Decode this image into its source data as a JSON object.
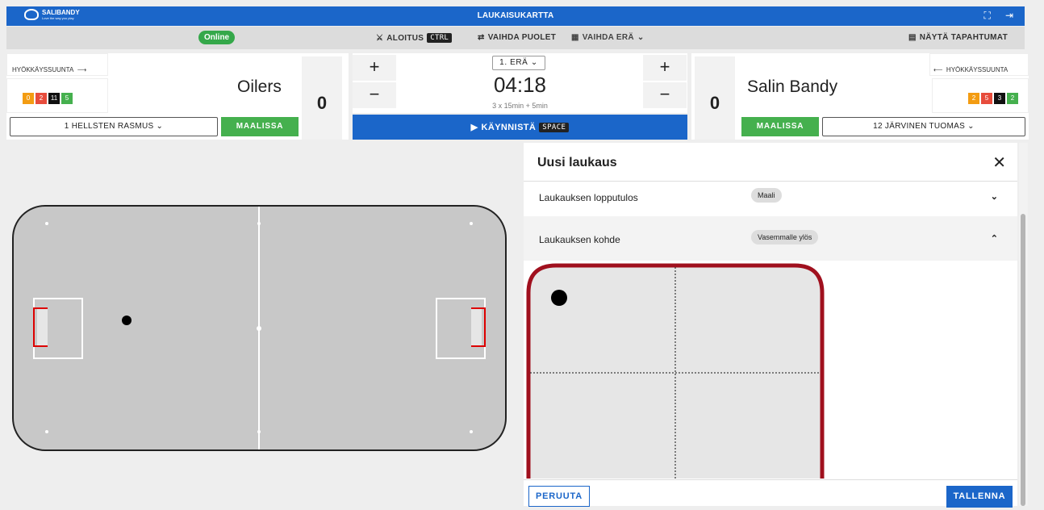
{
  "topbar": {
    "logo_text": "SALIBANDY",
    "logo_tagline": "Love the way you play",
    "title": "LAUKAISUKARTTA",
    "fullscreen_icon": "fullscreen-icon",
    "logout_icon": "logout-icon"
  },
  "toolbar": {
    "status": "Online",
    "faceoff_label": "ALOITUS",
    "faceoff_key": "CTRL",
    "switch_sides_label": "VAIHDA PUOLET",
    "switch_period_label": "VAIHDA ERÄ",
    "show_events_label": "NÄYTÄ TAPAHTUMAT"
  },
  "home": {
    "direction": "HYÖKKÄYSSUUNTA",
    "name": "Oilers",
    "score": "0",
    "chips": [
      {
        "value": "0",
        "color": "#f39c12"
      },
      {
        "value": "2",
        "color": "#e74c3c"
      },
      {
        "value": "11",
        "color": "#111111"
      },
      {
        "value": "5",
        "color": "#45b04e"
      }
    ],
    "goalie": "1 HELLSTEN RASMUS",
    "goalie_status": "MAALISSA"
  },
  "away": {
    "direction": "HYÖKKÄYSSUUNTA",
    "name": "Salin Bandy",
    "score": "0",
    "chips": [
      {
        "value": "2",
        "color": "#f39c12"
      },
      {
        "value": "5",
        "color": "#e74c3c"
      },
      {
        "value": "3",
        "color": "#111111"
      },
      {
        "value": "2",
        "color": "#45b04e"
      }
    ],
    "goalie": "12 JÄRVINEN TUOMAS",
    "goalie_status": "MAALISSA"
  },
  "clock": {
    "period": "1. ERÄ",
    "time": "04:18",
    "format": "3 x 15min + 5min",
    "start_label": "KÄYNNISTÄ",
    "start_key": "SPACE"
  },
  "panel": {
    "title": "Uusi laukaus",
    "result_label": "Laukauksen lopputulos",
    "result_value": "Maali",
    "target_label": "Laukauksen kohde",
    "target_value": "Vasemmalle ylös",
    "cancel_label": "PERUUTA",
    "save_label": "TALLENNA"
  }
}
